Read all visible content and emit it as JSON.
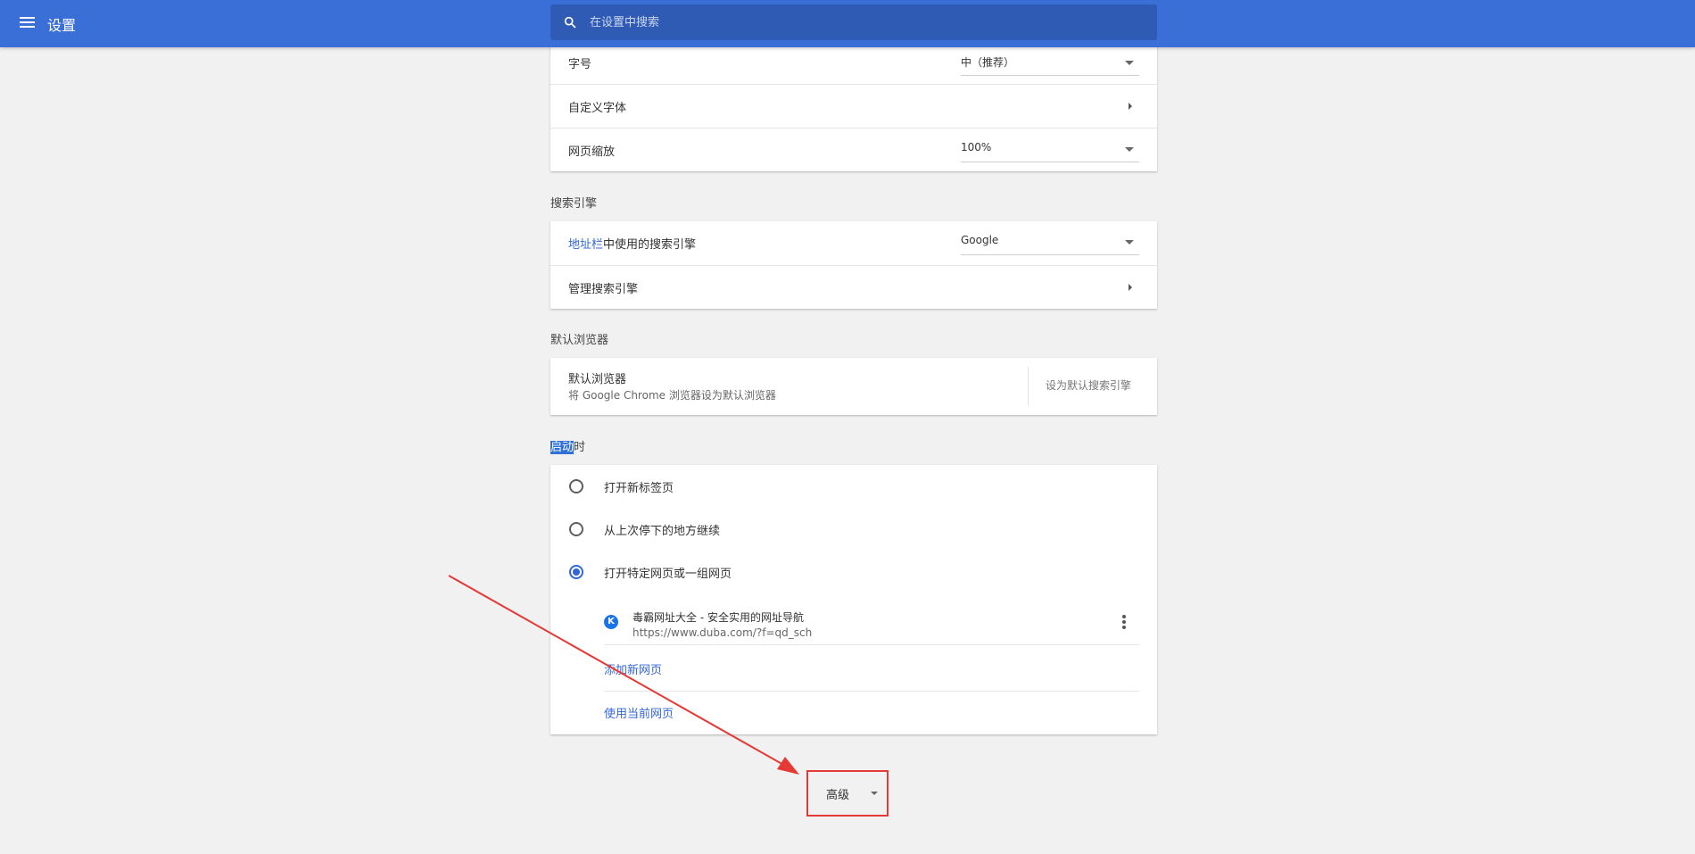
{
  "toolbar": {
    "title": "设置",
    "search_placeholder": "在设置中搜索"
  },
  "appearance": {
    "font_size_label": "字号",
    "font_size_value": "中（推荐）",
    "custom_fonts_label": "自定义字体",
    "page_zoom_label": "网页缩放",
    "page_zoom_value": "100%"
  },
  "search_engine": {
    "section_title": "搜索引擎",
    "address_bar_link": "地址栏",
    "address_bar_rest": "中使用的搜索引擎",
    "engine_value": "Google",
    "manage_label": "管理搜索引擎"
  },
  "default_browser": {
    "section_title": "默认浏览器",
    "title": "默认浏览器",
    "subtitle": "将 Google Chrome 浏览器设为默认浏览器",
    "button": "设为默认搜索引擎"
  },
  "on_startup": {
    "section_title_highlight": "启动",
    "section_title_rest": "时",
    "options": [
      {
        "label": "打开新标签页",
        "checked": false
      },
      {
        "label": "从上次停下的地方继续",
        "checked": false
      },
      {
        "label": "打开特定网页或一组网页",
        "checked": true
      }
    ],
    "page": {
      "favicon": "K",
      "title": "毒霸网址大全 - 安全实用的网址导航",
      "url": "https://www.duba.com/?f=qd_sch"
    },
    "add_page": "添加新网页",
    "use_current": "使用当前网页"
  },
  "advanced": {
    "label": "高级"
  },
  "colors": {
    "toolbar": "#3b6fd8",
    "accent": "#3367d6",
    "annotation": "#e53935"
  }
}
